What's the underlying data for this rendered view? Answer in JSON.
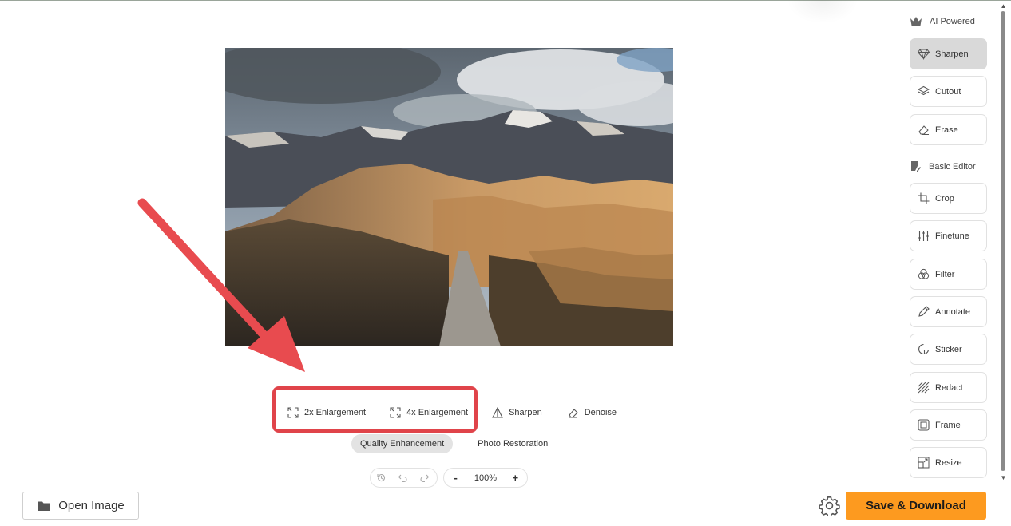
{
  "toolbar": {
    "tools": [
      {
        "label": "2x Enlargement",
        "icon": "expand-icon"
      },
      {
        "label": "4x Enlargement",
        "icon": "expand-icon"
      },
      {
        "label": "Sharpen",
        "icon": "sharpen-triangle-icon"
      },
      {
        "label": "Denoise",
        "icon": "eraser-icon"
      }
    ],
    "modes": [
      {
        "label": "Quality Enhancement",
        "active": true
      },
      {
        "label": "Photo Restoration",
        "active": false
      }
    ]
  },
  "zoom": {
    "minus": "-",
    "value": "100%",
    "plus": "+"
  },
  "open_image_label": "Open Image",
  "save_label": "Save & Download",
  "sidebar": {
    "ai_section": "AI Powered",
    "ai_items": [
      {
        "label": "Sharpen",
        "icon": "diamond-icon",
        "active": true
      },
      {
        "label": "Cutout",
        "icon": "layers-icon",
        "active": false
      },
      {
        "label": "Erase",
        "icon": "eraser-icon",
        "active": false
      }
    ],
    "basic_section": "Basic Editor",
    "basic_items": [
      {
        "label": "Crop",
        "icon": "crop-icon"
      },
      {
        "label": "Finetune",
        "icon": "sliders-icon"
      },
      {
        "label": "Filter",
        "icon": "filter-circles-icon"
      },
      {
        "label": "Annotate",
        "icon": "pencil-icon"
      },
      {
        "label": "Sticker",
        "icon": "sticker-icon"
      },
      {
        "label": "Redact",
        "icon": "hatch-icon"
      },
      {
        "label": "Frame",
        "icon": "frame-icon"
      },
      {
        "label": "Resize",
        "icon": "resize-icon"
      }
    ]
  },
  "colors": {
    "accent": "#fd9a1f",
    "highlight": "#e0444a",
    "active_item": "#d9d9d9"
  }
}
